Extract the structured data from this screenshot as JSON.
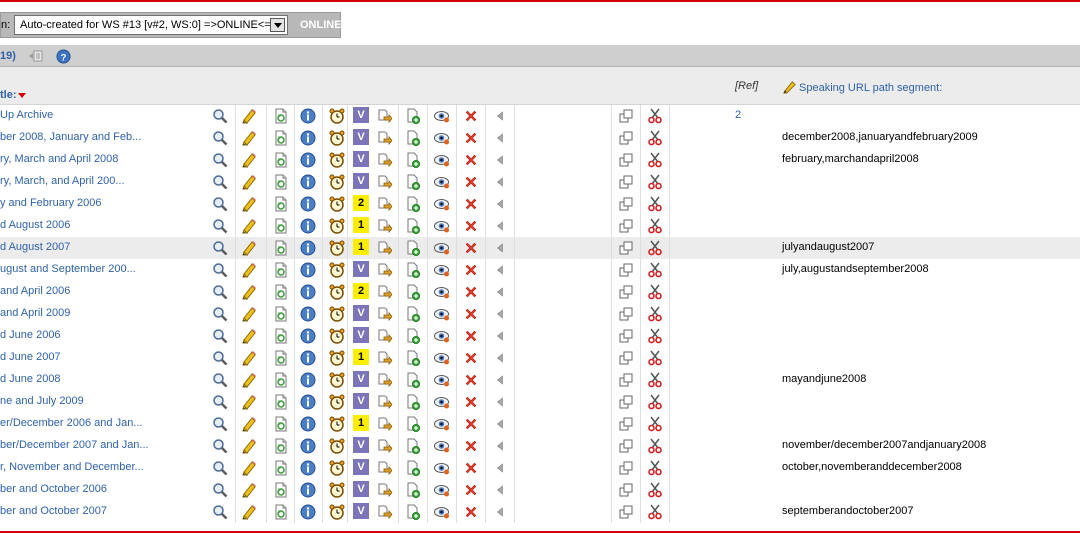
{
  "workspace": {
    "label": "n:",
    "selected": "Auto-created for WS #13 [v#2, WS:0] =>ONLINE<=",
    "status": "ONLINE"
  },
  "toolbar": {
    "count": "19)"
  },
  "header": {
    "title": "tle:",
    "ref": "[Ref]",
    "url_segment": "Speaking URL path segment:"
  },
  "colors": {
    "link": "#2f62a8",
    "version_badge": "#7a74b8",
    "number_badge": "#ffee00",
    "accent_red": "#d40000"
  },
  "rows": [
    {
      "title": "Up Archive",
      "badge": "V",
      "ref": "2",
      "segment": ""
    },
    {
      "title": "ber 2008, January and Feb...",
      "badge": "V",
      "ref": "",
      "segment": "december2008,januaryandfebruary2009"
    },
    {
      "title": "ry, March and April 2008",
      "badge": "V",
      "ref": "",
      "segment": "february,marchandapril2008"
    },
    {
      "title": "ry, March, and April 200...",
      "badge": "V",
      "ref": "",
      "segment": ""
    },
    {
      "title": "y and February 2006",
      "badge": "2",
      "ref": "",
      "segment": ""
    },
    {
      "title": "d August 2006",
      "badge": "1",
      "ref": "",
      "segment": ""
    },
    {
      "title": "d August 2007",
      "badge": "1",
      "ref": "",
      "segment": "julyandaugust2007"
    },
    {
      "title": "ugust and September 200...",
      "badge": "V",
      "ref": "",
      "segment": "july,augustandseptember2008"
    },
    {
      "title": "and April 2006",
      "badge": "2",
      "ref": "",
      "segment": ""
    },
    {
      "title": "and April 2009",
      "badge": "V",
      "ref": "",
      "segment": ""
    },
    {
      "title": "d June 2006",
      "badge": "V",
      "ref": "",
      "segment": ""
    },
    {
      "title": "d June 2007",
      "badge": "1",
      "ref": "",
      "segment": ""
    },
    {
      "title": "d June 2008",
      "badge": "V",
      "ref": "",
      "segment": "mayandjune2008"
    },
    {
      "title": "ne and July 2009",
      "badge": "V",
      "ref": "",
      "segment": ""
    },
    {
      "title": "er/December 2006 and Jan...",
      "badge": "1",
      "ref": "",
      "segment": ""
    },
    {
      "title": "ber/December 2007 and Jan...",
      "badge": "V",
      "ref": "",
      "segment": "november/december2007andjanuary2008"
    },
    {
      "title": "r, November and December...",
      "badge": "V",
      "ref": "",
      "segment": "october,novemberanddecember2008"
    },
    {
      "title": "ber and October 2006",
      "badge": "V",
      "ref": "",
      "segment": ""
    },
    {
      "title": "ber and October 2007",
      "badge": "V",
      "ref": "",
      "segment": "septemberandoctober2007"
    }
  ]
}
